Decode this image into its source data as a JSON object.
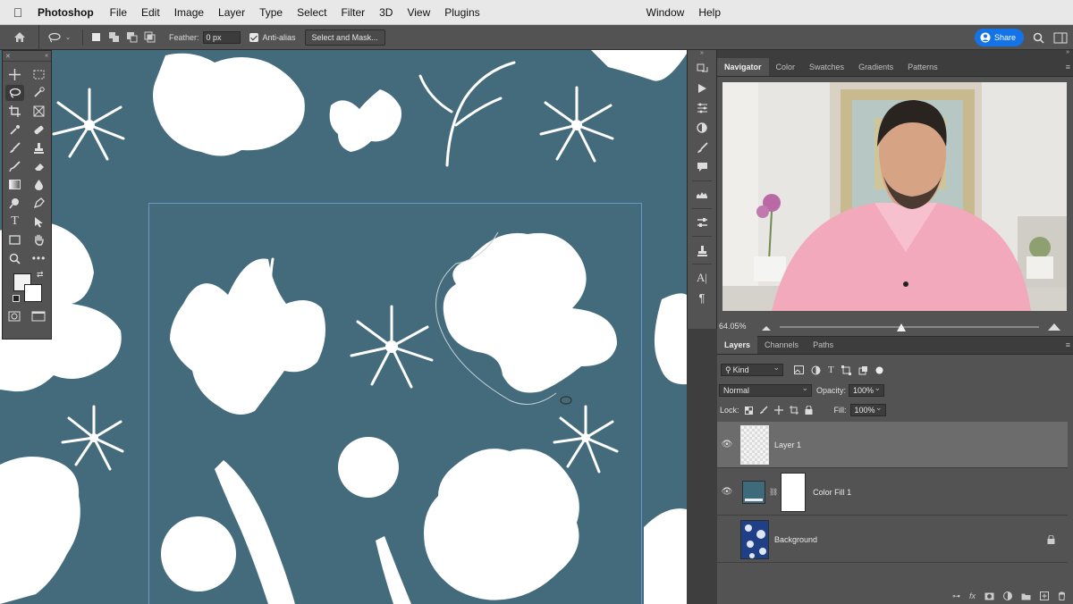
{
  "menubar": {
    "app_name": "Photoshop",
    "items": [
      "File",
      "Edit",
      "Image",
      "Layer",
      "Type",
      "Select",
      "Filter",
      "3D",
      "View",
      "Plugins"
    ],
    "right_items": [
      "Window",
      "Help"
    ]
  },
  "options": {
    "feather_label": "Feather:",
    "feather_value": "0 px",
    "antialias_label": "Anti-alias",
    "select_mask_label": "Select and Mask...",
    "share_label": "Share"
  },
  "navigator": {
    "tabs": [
      "Navigator",
      "Color",
      "Swatches",
      "Gradients",
      "Patterns"
    ],
    "zoom": "64.05%"
  },
  "layers_panel": {
    "tabs": [
      "Layers",
      "Channels",
      "Paths"
    ],
    "filter_kind": "Kind",
    "blend_mode": "Normal",
    "opacity_label": "Opacity:",
    "opacity_value": "100%",
    "lock_label": "Lock:",
    "fill_label": "Fill:",
    "fill_value": "100%",
    "layers": [
      {
        "name": "Layer 1",
        "visible": true,
        "selected": true
      },
      {
        "name": "Color Fill 1",
        "visible": true,
        "selected": false
      },
      {
        "name": "Background",
        "visible": false,
        "selected": false,
        "locked": true
      }
    ]
  },
  "colors": {
    "canvas": "#446b7c",
    "ui_panel": "#535353",
    "accent": "#1473e6",
    "fill_swatch": "#3d6b7b",
    "background_swatch": "#1f3f86"
  }
}
